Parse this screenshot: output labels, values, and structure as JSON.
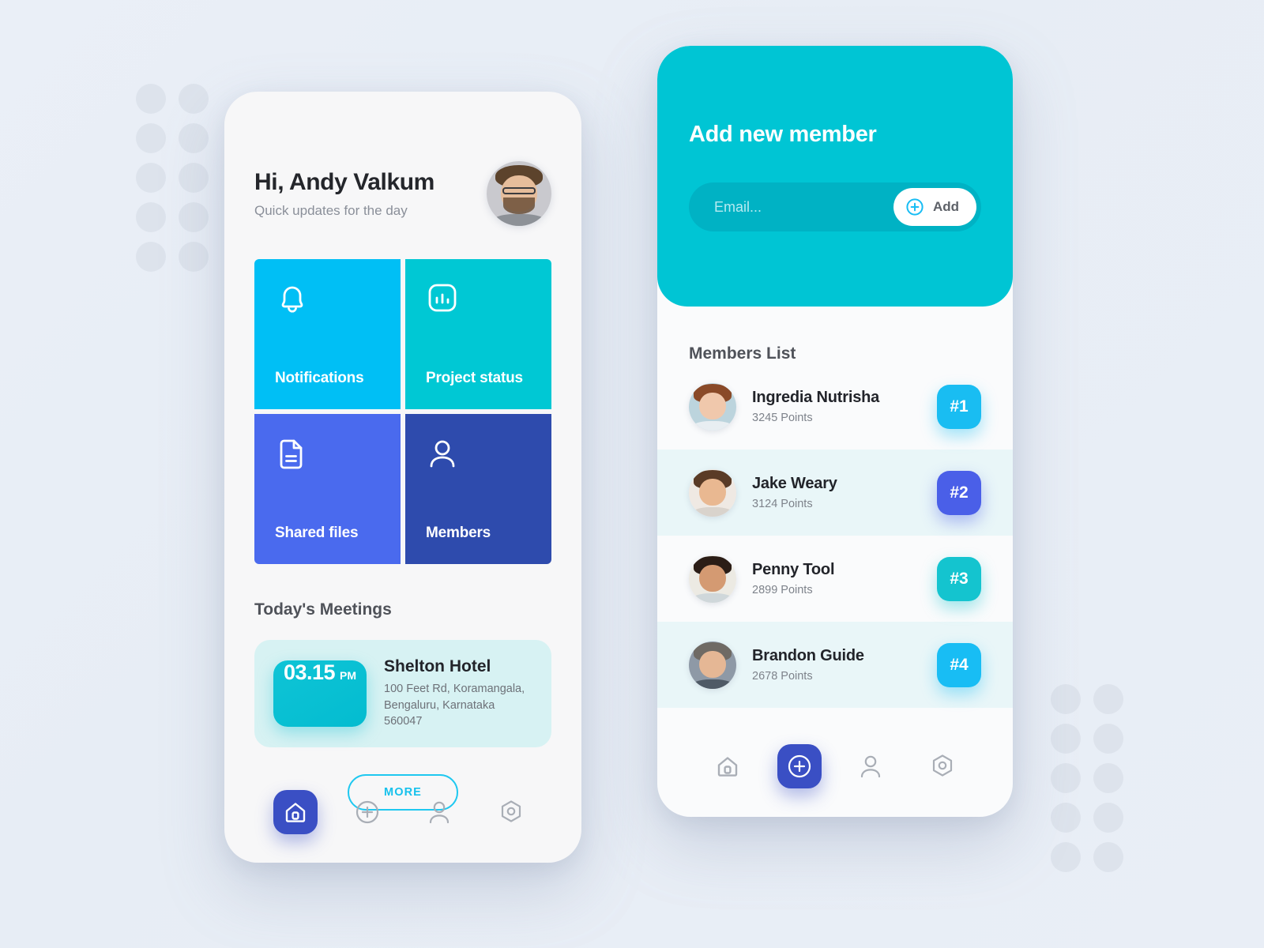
{
  "dashboard": {
    "greeting": "Hi, Andy Valkum",
    "subtitle": "Quick updates for the day",
    "avatar_name": "user-avatar",
    "tiles": [
      {
        "label": "Notifications",
        "icon": "bell-icon",
        "color": "#00bff5"
      },
      {
        "label": "Project status",
        "icon": "bar-chart-icon",
        "color": "#00c8d4"
      },
      {
        "label": "Shared files",
        "icon": "document-icon",
        "color": "#4a6aee"
      },
      {
        "label": "Members",
        "icon": "person-icon",
        "color": "#2e4bad"
      }
    ],
    "meetings_title": "Today's Meetings",
    "meeting": {
      "time": "03.15",
      "ampm": "PM",
      "name": "Shelton Hotel",
      "address_line1": "100 Feet Rd, Koramangala,",
      "address_line2": "Bengaluru, Karnataka 560047"
    },
    "more_label": "MORE",
    "nav": [
      {
        "icon": "home-icon",
        "active": true
      },
      {
        "icon": "plus-icon",
        "active": false
      },
      {
        "icon": "person-icon",
        "active": false
      },
      {
        "icon": "settings-hexagon-icon",
        "active": false
      }
    ]
  },
  "members_panel": {
    "title": "Add new member",
    "email_placeholder": "Email...",
    "add_label": "Add",
    "add_icon": "circle-plus-icon",
    "list_title": "Members List",
    "members": [
      {
        "name": "Ingredia Nutrisha",
        "points": "3245 Points",
        "rank": "#1",
        "rank_color": "#19bdf2"
      },
      {
        "name": "Jake Weary",
        "points": "3124 Points",
        "rank": "#2",
        "rank_color": "#4a5fe8"
      },
      {
        "name": "Penny Tool",
        "points": "2899 Points",
        "rank": "#3",
        "rank_color": "#14c4cf"
      },
      {
        "name": "Brandon Guide",
        "points": "2678 Points",
        "rank": "#4",
        "rank_color": "#18bdf4"
      }
    ],
    "nav": [
      {
        "icon": "home-icon",
        "active": false
      },
      {
        "icon": "plus-icon",
        "active": true
      },
      {
        "icon": "person-icon",
        "active": false
      },
      {
        "icon": "settings-hexagon-icon",
        "active": false
      }
    ]
  }
}
